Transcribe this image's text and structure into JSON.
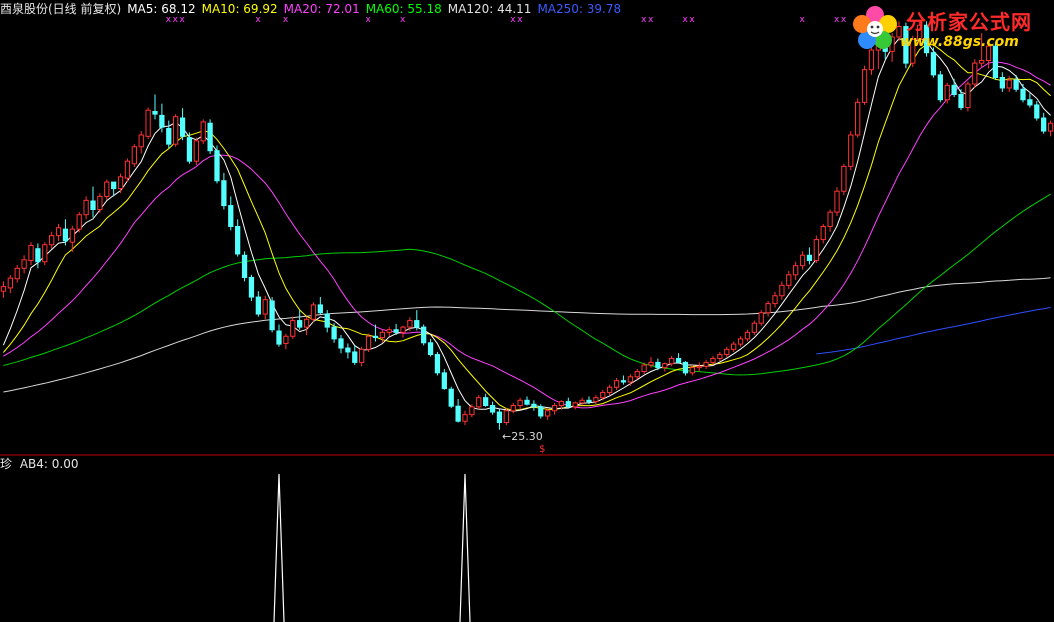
{
  "header": {
    "stock_title": "酉泉股份(日线 前复权)",
    "ma": [
      {
        "label": "MA5: 68.12",
        "color": "#ffffff"
      },
      {
        "label": "MA10: 69.92",
        "color": "#ffff00"
      },
      {
        "label": "MA20: 72.01",
        "color": "#ff40ff"
      },
      {
        "label": "MA60: 55.18",
        "color": "#00ff00"
      },
      {
        "label": "MA120: 44.11",
        "color": "#e0e0e0"
      },
      {
        "label": "MA250: 39.78",
        "color": "#3b5bff"
      }
    ]
  },
  "indicator": {
    "name": "珍",
    "value_label": "AB4: 0.00"
  },
  "logo": {
    "text": "分析家公式网",
    "url": "www.88gs.com"
  },
  "annotations": {
    "low_label": "←25.30",
    "marker_glyph": "$",
    "cross_glyph": "x"
  },
  "colors": {
    "up": "#ff3232",
    "down": "#54ffff",
    "ma5": "#ffffff",
    "ma10": "#ffff00",
    "ma20": "#ff40ff",
    "ma60": "#00d000",
    "ma120": "#d8d8d8",
    "ma250": "#2f4fff",
    "divider": "#c00000",
    "indicator": "#ffffff"
  },
  "chart_data": {
    "type": "candlestick",
    "price_range": [
      22.5,
      88
    ],
    "ohlc": [
      [
        46.5,
        48,
        45.5,
        47.2
      ],
      [
        47,
        49,
        46.2,
        48.5
      ],
      [
        48.4,
        50.5,
        47.8,
        50
      ],
      [
        50,
        52,
        49.2,
        51.3
      ],
      [
        51.2,
        54,
        50.5,
        53.5
      ],
      [
        53,
        53.8,
        50,
        51
      ],
      [
        51,
        54,
        50.5,
        53.6
      ],
      [
        53.6,
        55.6,
        53,
        55
      ],
      [
        55,
        56.8,
        54.2,
        56.2
      ],
      [
        56,
        57.5,
        53.5,
        54.2
      ],
      [
        54,
        56.5,
        52.5,
        56
      ],
      [
        56,
        58.6,
        55.5,
        58.2
      ],
      [
        58.2,
        61,
        57.5,
        60.4
      ],
      [
        60.3,
        62.5,
        57.8,
        59
      ],
      [
        59,
        61.5,
        58.5,
        61
      ],
      [
        61,
        63.6,
        60.5,
        63.2
      ],
      [
        63.2,
        62.8,
        61,
        62.2
      ],
      [
        62.2,
        64.5,
        61.5,
        64
      ],
      [
        63.8,
        66.8,
        63.2,
        66.4
      ],
      [
        66,
        69,
        65.5,
        68.6
      ],
      [
        68.6,
        71,
        67.6,
        70.4
      ],
      [
        70.2,
        74.6,
        69.8,
        74.2
      ],
      [
        74,
        76.6,
        72.8,
        73.6
      ],
      [
        73.4,
        75.2,
        70.8,
        71.6
      ],
      [
        71.4,
        72.6,
        68.4,
        69
      ],
      [
        69,
        73.6,
        68.6,
        73.2
      ],
      [
        73,
        74.5,
        69.6,
        70.2
      ],
      [
        70,
        70.8,
        66,
        66.4
      ],
      [
        66.4,
        70,
        65.8,
        69.5
      ],
      [
        69.5,
        72.8,
        69,
        72.4
      ],
      [
        72.2,
        72.8,
        67.5,
        68
      ],
      [
        68,
        68.8,
        63,
        63.4
      ],
      [
        63.4,
        64.6,
        59,
        59.6
      ],
      [
        59.6,
        61,
        55.8,
        56.4
      ],
      [
        56.4,
        57.5,
        51.8,
        52.2
      ],
      [
        52,
        52.6,
        48,
        48.6
      ],
      [
        48.6,
        49,
        45,
        45.6
      ],
      [
        45.6,
        46.5,
        42.6,
        43
      ],
      [
        43,
        45.8,
        42.2,
        45.2
      ],
      [
        45,
        45.6,
        40.2,
        40.6
      ],
      [
        40.4,
        41.4,
        38,
        38.4
      ],
      [
        38.5,
        40,
        37.6,
        39.6
      ],
      [
        39.6,
        42.6,
        39.2,
        42
      ],
      [
        42,
        43.6,
        40.6,
        41
      ],
      [
        41,
        42.6,
        39.8,
        42.2
      ],
      [
        42.2,
        44.8,
        41.8,
        44.4
      ],
      [
        44.4,
        45.6,
        43,
        43.2
      ],
      [
        43,
        43.6,
        40.2,
        41
      ],
      [
        41,
        41.6,
        38.6,
        39.2
      ],
      [
        39.2,
        39.8,
        37,
        37.8
      ],
      [
        37.8,
        38.5,
        36.2,
        37.2
      ],
      [
        37.2,
        38.2,
        35.2,
        35.6
      ],
      [
        35.6,
        38,
        35,
        37.6
      ],
      [
        37.6,
        40,
        37.2,
        39.6
      ],
      [
        39.6,
        41.4,
        38.8,
        39.4
      ],
      [
        39.4,
        40.6,
        38.6,
        40.2
      ],
      [
        40.2,
        41,
        39.6,
        40.6
      ],
      [
        40.6,
        41.5,
        39.8,
        40.2
      ],
      [
        40.2,
        41.2,
        39.4,
        41
      ],
      [
        41,
        42.5,
        40.4,
        42
      ],
      [
        42,
        43.6,
        40.5,
        41
      ],
      [
        41,
        41.4,
        38.2,
        38.6
      ],
      [
        38.6,
        39.2,
        36.5,
        36.8
      ],
      [
        36.8,
        37.2,
        33.6,
        34
      ],
      [
        34,
        34.6,
        31.4,
        31.6
      ],
      [
        31.5,
        31.9,
        28.6,
        28.9
      ],
      [
        28.9,
        30,
        26.4,
        26.6
      ],
      [
        26.6,
        28.2,
        26,
        27.6
      ],
      [
        27.6,
        29.2,
        27.2,
        28.8
      ],
      [
        28.8,
        30.6,
        28.4,
        30.2
      ],
      [
        30.2,
        30.8,
        28.8,
        29
      ],
      [
        29,
        29.6,
        27.6,
        28
      ],
      [
        28,
        28.4,
        25.3,
        26.4
      ],
      [
        26.4,
        28.6,
        26,
        28.2
      ],
      [
        28.2,
        29.4,
        27.8,
        29
      ],
      [
        29,
        30.2,
        28.4,
        29.8
      ],
      [
        29.8,
        30.4,
        29,
        29.2
      ],
      [
        29.2,
        29.8,
        28.2,
        28.8
      ],
      [
        28.8,
        29.2,
        27,
        27.4
      ],
      [
        27.4,
        28.6,
        26.8,
        28.2
      ],
      [
        28.2,
        29.4,
        27.6,
        29
      ],
      [
        29,
        29.8,
        28.4,
        29.6
      ],
      [
        29.6,
        30.2,
        28.6,
        28.8
      ],
      [
        28.8,
        29.6,
        28.4,
        29.4
      ],
      [
        29.4,
        30.2,
        29,
        29.8
      ],
      [
        29.8,
        30.4,
        29.2,
        29.6
      ],
      [
        29.6,
        30.6,
        29.2,
        30.2
      ],
      [
        30.2,
        31.4,
        29.8,
        31
      ],
      [
        31,
        32.2,
        30.6,
        31.8
      ],
      [
        31.8,
        33.2,
        31.4,
        32.8
      ],
      [
        32.8,
        33.6,
        32.2,
        32.6
      ],
      [
        32.6,
        33.8,
        32,
        33.4
      ],
      [
        33.4,
        34.6,
        33,
        34.2
      ],
      [
        34.2,
        35.6,
        33.8,
        35.2
      ],
      [
        35.2,
        36.4,
        34.8,
        35.6
      ],
      [
        35.6,
        36.2,
        34.4,
        34.8
      ],
      [
        34.8,
        35.6,
        34.2,
        35.4
      ],
      [
        35.4,
        36.6,
        35,
        36.2
      ],
      [
        36.2,
        37,
        35.4,
        35.6
      ],
      [
        35.6,
        35.8,
        33.6,
        34
      ],
      [
        34,
        35.2,
        33.6,
        34.8
      ],
      [
        34.8,
        35.6,
        34.2,
        35
      ],
      [
        35,
        36,
        34.6,
        35.6
      ],
      [
        35.6,
        36.6,
        35.2,
        36.2
      ],
      [
        36.2,
        37.2,
        35.8,
        36.8
      ],
      [
        36.8,
        38,
        36.4,
        37.6
      ],
      [
        37.6,
        38.8,
        37.2,
        38.4
      ],
      [
        38.4,
        39.6,
        38,
        39.2
      ],
      [
        39.2,
        40.6,
        38.8,
        40.2
      ],
      [
        40.2,
        42,
        39.8,
        41.6
      ],
      [
        41.6,
        43.6,
        41.2,
        43.2
      ],
      [
        43.2,
        45,
        42.6,
        44.6
      ],
      [
        44.6,
        46.4,
        44,
        45.8
      ],
      [
        45.8,
        48,
        45.2,
        47.4
      ],
      [
        47.4,
        49.6,
        46.8,
        49
      ],
      [
        49,
        51,
        48.2,
        50.4
      ],
      [
        50.4,
        52.6,
        49.8,
        52
      ],
      [
        52,
        53.2,
        50.6,
        51.2
      ],
      [
        51.2,
        55,
        50.8,
        54.4
      ],
      [
        54.4,
        56.8,
        53.8,
        56.4
      ],
      [
        56.4,
        59,
        55.6,
        58.6
      ],
      [
        58.6,
        62.4,
        58,
        61.8
      ],
      [
        61.8,
        66,
        61.2,
        65.6
      ],
      [
        65.6,
        71,
        65,
        70.4
      ],
      [
        70.4,
        76,
        70,
        75.4
      ],
      [
        75.4,
        81,
        75,
        80.4
      ],
      [
        80.4,
        84,
        79.6,
        83.4
      ],
      [
        83.4,
        87,
        80.5,
        86.8
      ],
      [
        86.6,
        87.6,
        82,
        83.2
      ],
      [
        83.2,
        86,
        81.6,
        85.4
      ],
      [
        85.4,
        87.8,
        84.8,
        87
      ],
      [
        87,
        87.6,
        80.6,
        81.4
      ],
      [
        81.4,
        85.6,
        80.8,
        85
      ],
      [
        85,
        87.8,
        84.2,
        87.2
      ],
      [
        87.2,
        87.8,
        82.4,
        83
      ],
      [
        83,
        83.8,
        79.2,
        79.6
      ],
      [
        79.6,
        80.2,
        75.4,
        75.8
      ],
      [
        75.8,
        78.4,
        75.2,
        78
      ],
      [
        78,
        79,
        76.2,
        76.6
      ],
      [
        76.6,
        77.4,
        74.2,
        74.6
      ],
      [
        74.6,
        78.6,
        74,
        78.2
      ],
      [
        78.2,
        82,
        77.6,
        81.4
      ],
      [
        81.4,
        86,
        80.8,
        81.8
      ],
      [
        81.8,
        84.6,
        80.6,
        84
      ],
      [
        84,
        84.6,
        78.8,
        79.2
      ],
      [
        79.2,
        80,
        77,
        77.6
      ],
      [
        77.6,
        79.4,
        77,
        78.8
      ],
      [
        78.8,
        79.6,
        77,
        77.4
      ],
      [
        77.4,
        78.2,
        75.4,
        75.8
      ],
      [
        75.8,
        76.8,
        74.6,
        75
      ],
      [
        75,
        75.6,
        72.6,
        73
      ],
      [
        73,
        73.8,
        70.6,
        71
      ],
      [
        71,
        72.6,
        70.2,
        72.2
      ]
    ],
    "ma_periods": {
      "ma5": 5,
      "ma10": 10,
      "ma20": 20,
      "ma60": 60,
      "ma120": 120,
      "ma250": 250
    },
    "indicator_ab4": {
      "range": [
        0,
        1
      ],
      "spike_bars": [
        40,
        67
      ],
      "latest": 0.0
    },
    "cross_marker_bars": [
      24,
      25,
      26,
      37,
      41,
      53,
      58,
      74,
      75,
      93,
      94,
      99,
      100,
      116,
      121,
      122
    ]
  }
}
